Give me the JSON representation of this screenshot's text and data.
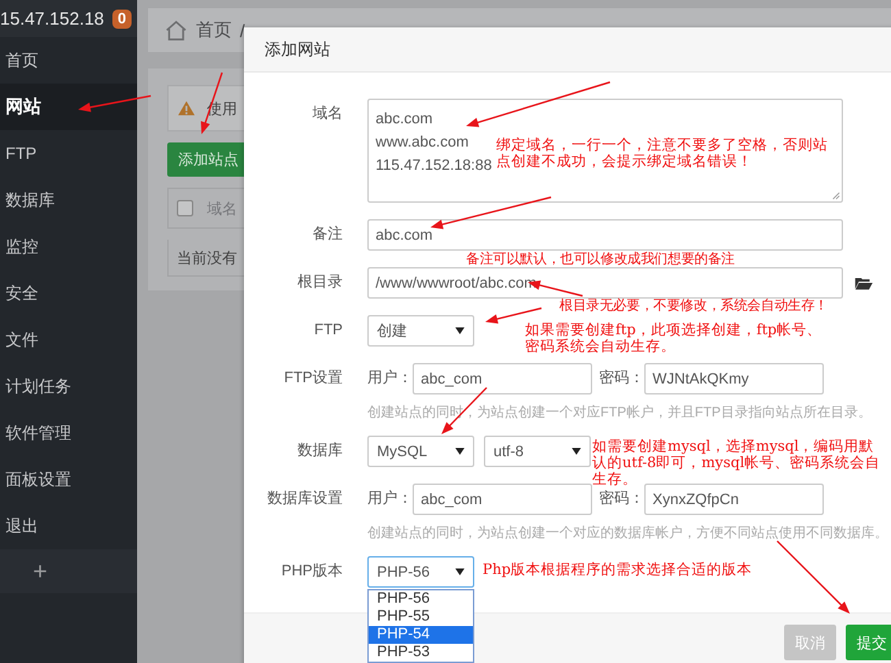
{
  "sidebar": {
    "server_ip": "15.47.152.18",
    "badge": "0",
    "items": [
      {
        "label": "首页",
        "selected": false
      },
      {
        "label": "网站",
        "selected": true
      },
      {
        "label": "FTP",
        "selected": false
      },
      {
        "label": "数据库",
        "selected": false
      },
      {
        "label": "监控",
        "selected": false
      },
      {
        "label": "安全",
        "selected": false
      },
      {
        "label": "文件",
        "selected": false
      },
      {
        "label": "计划任务",
        "selected": false
      },
      {
        "label": "软件管理",
        "selected": false
      },
      {
        "label": "面板设置",
        "selected": false
      },
      {
        "label": "退出",
        "selected": false
      }
    ],
    "add_label": "+"
  },
  "main": {
    "breadcrumb": [
      "首页",
      "/"
    ],
    "alert_text": "使用",
    "add_site_button": "添加站点",
    "select_all_checked": false,
    "table_header": "域名",
    "empty_text": "当前没有"
  },
  "modal": {
    "title": "添加网站",
    "rows": [
      {
        "kind": "textarea",
        "label": "域名",
        "lines": [
          "abc.com",
          "www.abc.com",
          "115.47.152.18:88"
        ]
      },
      {
        "kind": "input",
        "label": "备注",
        "value": "abc.com"
      },
      {
        "kind": "folder_input",
        "label": "根目录",
        "value": "/www/wwwroot/abc.com"
      },
      {
        "kind": "select",
        "label": "FTP",
        "values": [
          "创建"
        ]
      },
      {
        "kind": "credentials",
        "label": "FTP设置",
        "user_label": "用户：",
        "user": "abc_com",
        "password_label": "密码：",
        "password": "WJNtAkQKmy"
      },
      {
        "kind": "hint",
        "text": "创建站点的同时，为站点创建一个对应FTP帐户，并且FTP目录指向站点所在目录。"
      },
      {
        "kind": "select",
        "label": "数据库",
        "values": [
          "MySQL",
          "utf-8"
        ]
      },
      {
        "kind": "credentials",
        "label": "数据库设置",
        "user_label": "用户：",
        "user": "abc_com",
        "password_label": "密码：",
        "password": "XynxZQfpCn"
      },
      {
        "kind": "hint",
        "text": "创建站点的同时，为站点创建一个对应的数据库帐户，方便不同站点使用不同数据库。"
      },
      {
        "kind": "select",
        "label": "PHP版本",
        "values": [
          "PHP-56"
        ],
        "options": [
          {
            "label": "PHP-56",
            "selected": false
          },
          {
            "label": "PHP-55",
            "selected": false
          },
          {
            "label": "PHP-54",
            "selected": true
          },
          {
            "label": "PHP-53",
            "selected": false
          }
        ]
      }
    ],
    "cancel_button": "取消",
    "submit_button": "提交"
  },
  "annotations": [
    {
      "text": "绑定域名，一行一个，注意不要多了空格，否则站点创建不成功，会提示绑定域名错误！"
    },
    {
      "text": "备注可以默认，也可以修改成我们想要的备注"
    },
    {
      "text": "根目录无必要，不要修改，系统会自动生存！"
    },
    {
      "text": "如果需要创建ftp，此项选择创建，ftp帐号、密码系统会自动生存。"
    },
    {
      "text": "如需要创建mysql，选择mysql，编码用默认的utf-8即可，mysql帐号、密码系统会自生存。"
    },
    {
      "text": "Php版本根据程序的需求选择合适的版本"
    }
  ]
}
